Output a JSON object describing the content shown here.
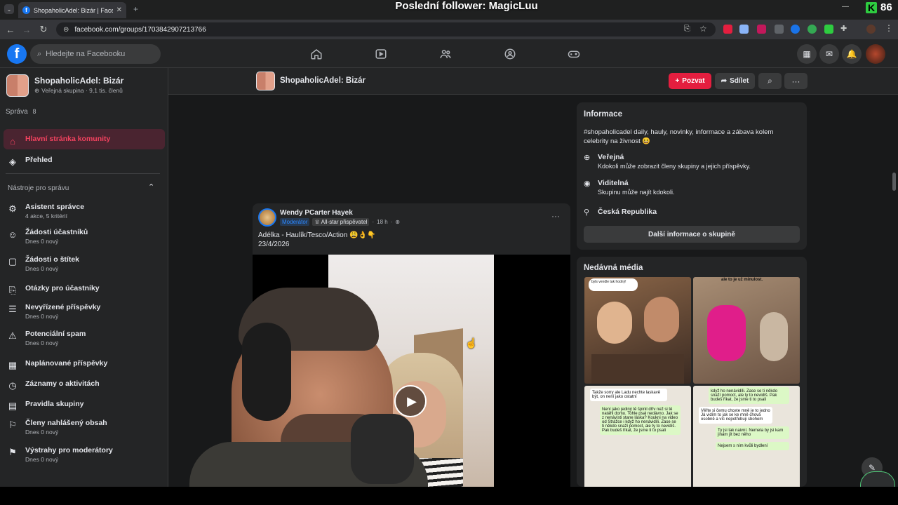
{
  "browser": {
    "tab_title": "ShopaholicAdel: Bizár | Faceboo",
    "url": "facebook.com/groups/1703842907213766",
    "overlay_title": "Poslední follower: MagicLuu",
    "kick_count": "86",
    "kick_letter": "K"
  },
  "fb": {
    "search_placeholder": "Hledejte na Facebooku"
  },
  "sidebar": {
    "group_name": "ShopaholicAdel: Bizár",
    "group_meta": "Veřejná skupina · 9,1 tis. členů",
    "manage_label": "Správa",
    "manage_count": "8",
    "home_label": "Hlavní stránka komunity",
    "overview_label": "Přehled",
    "tools_header": "Nástroje pro správu",
    "items": [
      {
        "label": "Asistent správce",
        "sub": "4 akce, 5 kritérií"
      },
      {
        "label": "Žádosti účastníků",
        "sub": "Dnes 0 nový"
      },
      {
        "label": "Žádosti o štítek",
        "sub": "Dnes 0 nový"
      },
      {
        "label": "Otázky pro účastníky",
        "sub": ""
      },
      {
        "label": "Nevyřízené příspěvky",
        "sub": "Dnes 0 nový"
      },
      {
        "label": "Potenciální spam",
        "sub": "Dnes 0 nový"
      },
      {
        "label": "Naplánované příspěvky",
        "sub": ""
      },
      {
        "label": "Záznamy o aktivitách",
        "sub": ""
      },
      {
        "label": "Pravidla skupiny",
        "sub": ""
      },
      {
        "label": "Členy nahlášený obsah",
        "sub": "Dnes 0 nový"
      },
      {
        "label": "Výstrahy pro moderátory",
        "sub": "Dnes 0 nový"
      }
    ]
  },
  "groupbar": {
    "title": "ShopaholicAdel: Bizár",
    "invite": "Pozvat",
    "share": "Sdílet"
  },
  "post": {
    "author": "Wendy PCarter Hayek",
    "badge_mod": "Moderátor",
    "badge_star": "All-star přispěvatel",
    "time": "18 h",
    "text": "Adélka - Haulík/Tesco/Action 😩👌👇",
    "date": "23/4/2026"
  },
  "info": {
    "title": "Informace",
    "description": "#shopaholicadel daily, hauly, novinky, informace a zábava kolem celebrity na živnost 😆",
    "public_h": "Veřejná",
    "public_s": "Kdokoli může zobrazit členy skupiny a jejich příspěvky.",
    "visible_h": "Viditelná",
    "visible_s": "Skupinu může najít kdokoli.",
    "location": "Česká Republika",
    "more_btn": "Další informace o skupině"
  },
  "media": {
    "title": "Nedávná média",
    "bubble1": "byls vendle tak hodný!",
    "bubble2": "ale to je už minulost.",
    "chat1": "Takže sorry ale Ladu nechte laskavě být, on není jako ostatní",
    "chat1b": "Není jako jediný tě špinil dřív než si tě natáhl domu. Tohle psal nedávno. Jak se z nenávisti stane láska? Koukni na video od Strážce i když ho nenávidíli. Zase se ti někdo snaží pomoct, ale ty to nevidíš. Pak budeš říkat, že jsme ti to psali",
    "chat2": "když ho nenávidíli. Zase se ti někdo snaží pomoct, ale ty to nevidíš. Pak budeš říkat, že jsme ti to psali",
    "chat2b": "Věřte si čemu chcete mně je to jedno Já vidím to jak se ke mně chová osobně a víc nepotřebuji sbohem",
    "chat2c": "Ty jsi tak naivní. Nemela by jsi kam jinam jít bez něho",
    "chat2d": "Nejsem s ním kvůli bydlení"
  },
  "colors": {
    "accent": "#1877f2",
    "invite_red": "#e41e3f",
    "bg": "#18191a",
    "card": "#242526"
  }
}
